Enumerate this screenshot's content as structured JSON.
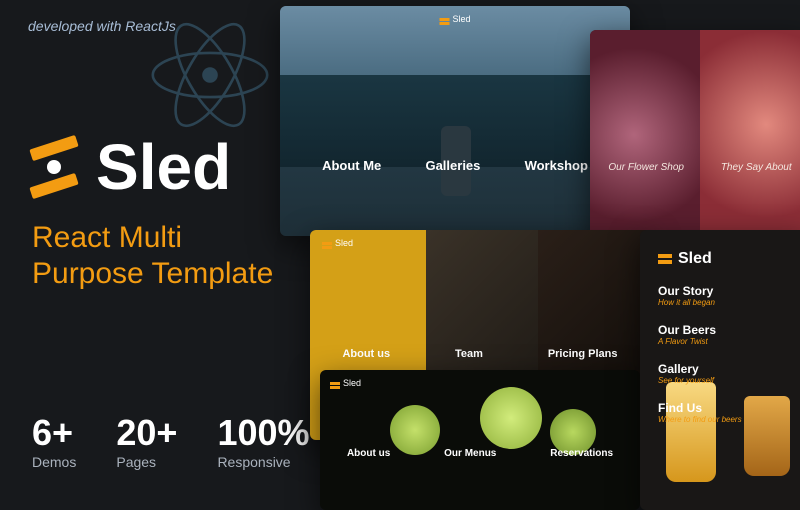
{
  "tagline": "developed with ReactJs",
  "brand_name": "Sled",
  "subtitle_line1": "React Multi",
  "subtitle_line2": "Purpose Template",
  "stats": [
    {
      "num": "6+",
      "label": "Demos"
    },
    {
      "num": "20+",
      "label": "Pages"
    },
    {
      "num": "100%",
      "label": "Responsive"
    }
  ],
  "demo_photo": {
    "brand": "Sled",
    "links": [
      "About Me",
      "Galleries",
      "Workshop"
    ]
  },
  "demo_florist": {
    "labels": [
      "Our Flower Shop",
      "They Say About"
    ]
  },
  "demo_gym": {
    "brand": "Sled",
    "labels": [
      "About us",
      "Team",
      "Pricing Plans"
    ]
  },
  "demo_food": {
    "brand": "Sled",
    "labels": [
      "About us",
      "Our Menus",
      "Reservations"
    ]
  },
  "demo_beer": {
    "brand": "Sled",
    "items": [
      {
        "title": "Our Story",
        "sub": "How it all began"
      },
      {
        "title": "Our Beers",
        "sub": "A Flavor Twist"
      },
      {
        "title": "Gallery",
        "sub": "See for yourself"
      },
      {
        "title": "Find Us",
        "sub": "Where to find our beers"
      }
    ]
  }
}
